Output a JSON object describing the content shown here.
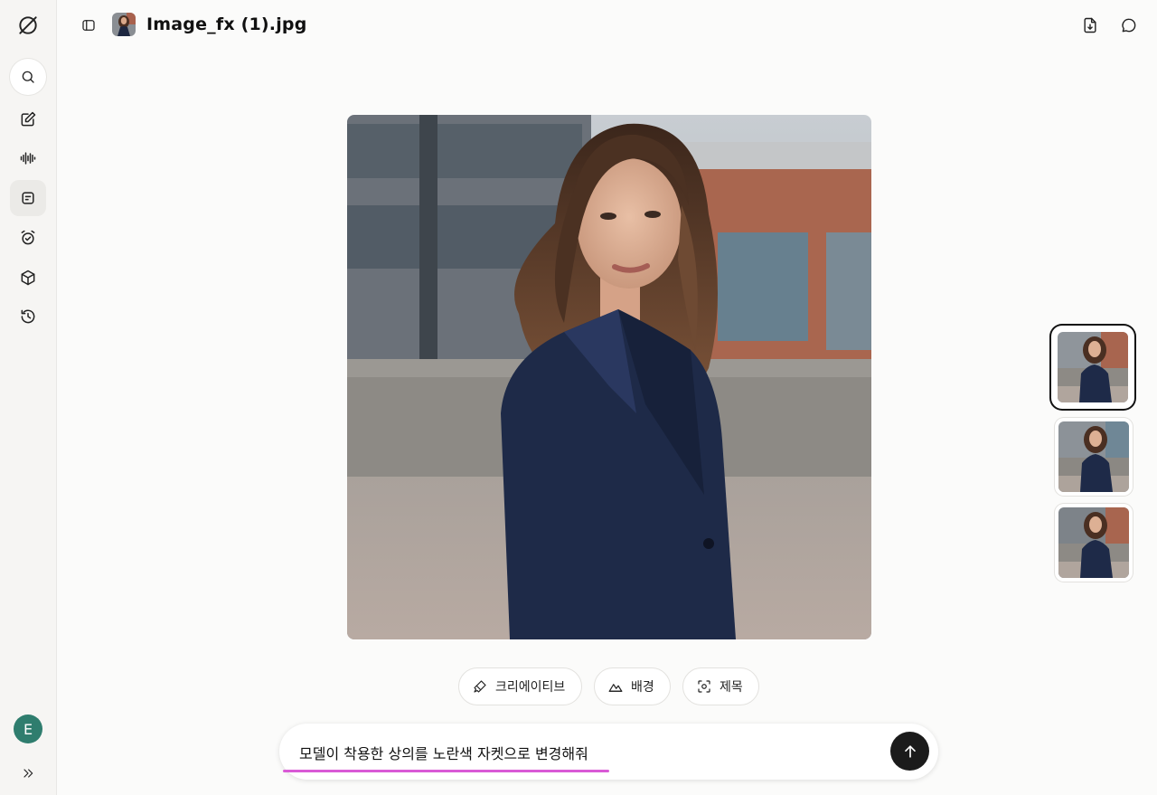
{
  "app": {
    "file_title": "Image_fx (1).jpg",
    "user_initial": "E"
  },
  "sidebar": {
    "items": [
      {
        "name": "logo-icon"
      },
      {
        "name": "search-icon"
      },
      {
        "name": "edit-icon"
      },
      {
        "name": "audio-wave-icon"
      },
      {
        "name": "notes-icon"
      },
      {
        "name": "alarm-icon"
      },
      {
        "name": "cube-icon"
      },
      {
        "name": "history-icon"
      }
    ]
  },
  "actions": {
    "creative_label": "크리에이티브",
    "background_label": "배경",
    "subject_label": "제목"
  },
  "composer": {
    "text": "모델이 착용한 상의를 노란색 자켓으로 변경해줘"
  },
  "thumbnails": {
    "count": 3,
    "selected_index": 0
  },
  "colors": {
    "accent_underline": "#d95ad6",
    "avatar_bg": "#2f7d6e",
    "send_bg": "#1b1b1b"
  }
}
